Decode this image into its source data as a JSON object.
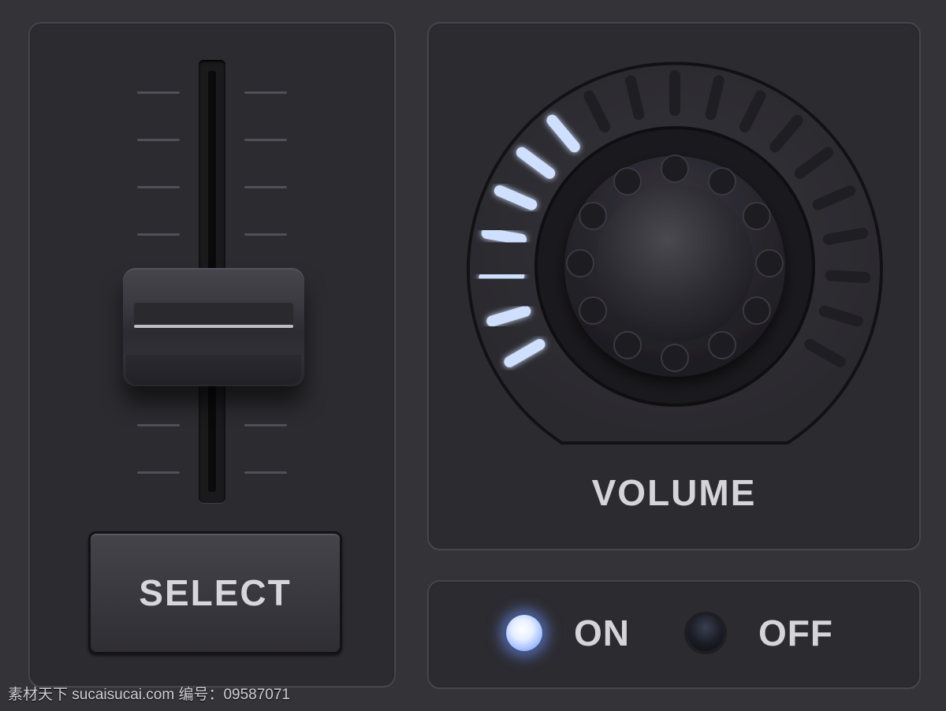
{
  "fader": {
    "button_label": "SELECT",
    "tick_count": 8,
    "position": 0.57
  },
  "volume": {
    "label": "VOLUME",
    "segments_total": 19,
    "segments_lit": 7,
    "lit_color": "#cfe0ff",
    "glow_color": "#5c8cff",
    "unlit_color": "#1f1e23"
  },
  "power": {
    "on_label": "ON",
    "off_label": "OFF",
    "state": "on"
  },
  "watermark": "素材天下 sucaisucai.com  编号：09587071"
}
